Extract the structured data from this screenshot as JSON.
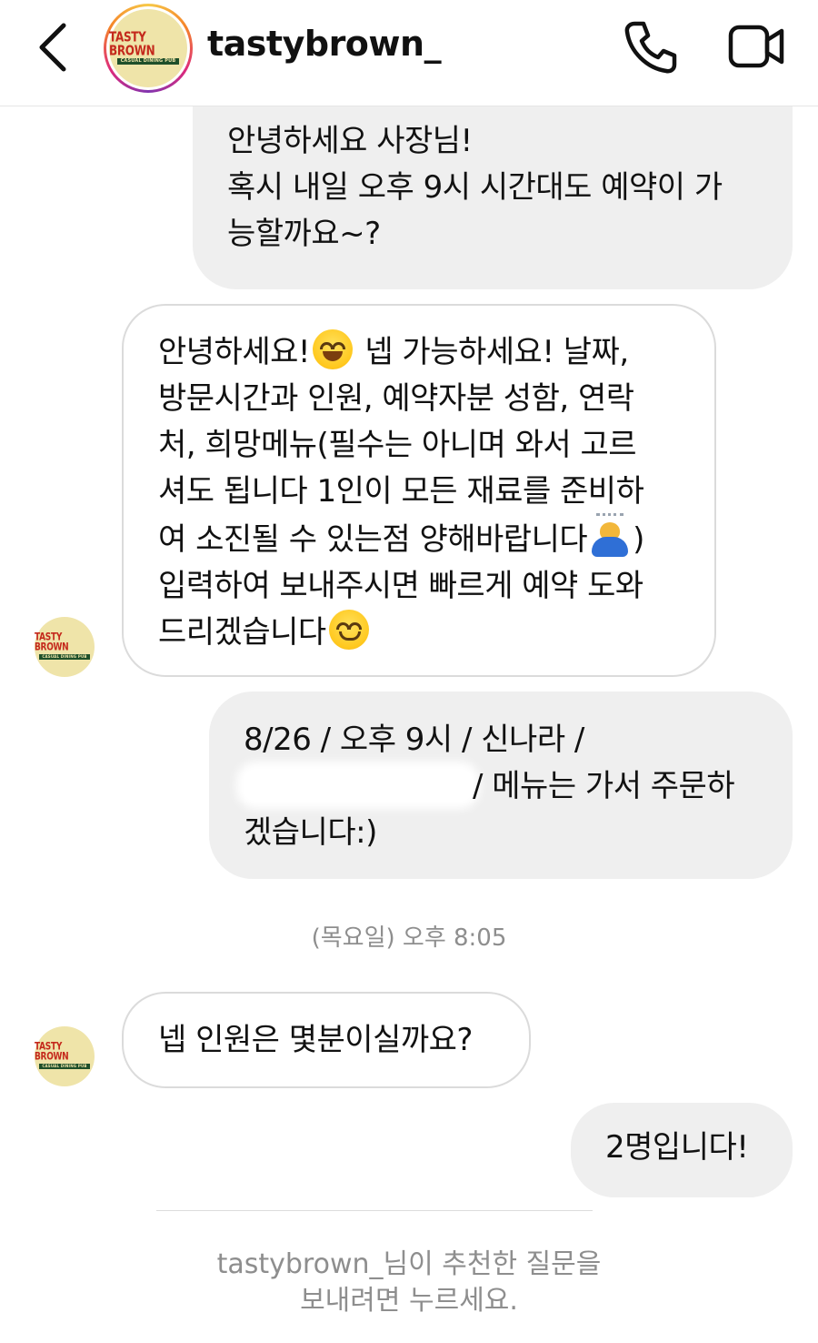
{
  "header": {
    "username": "tastybrown_",
    "back_icon": "chevron-left-icon",
    "call_icon": "phone-icon",
    "video_icon": "video-camera-icon"
  },
  "profile_logo": {
    "name": "TASTY BROWN",
    "subtitle": "CASUAL DINING PUB"
  },
  "messages": [
    {
      "direction": "outgoing",
      "lines": [
        "안녕하세요 사장님!",
        "혹시 내일 오후 9시 시간대도 예약이 가",
        "능할까요~?"
      ]
    },
    {
      "direction": "incoming",
      "line1_a": "안녕하세요!",
      "line1_b": " 넵 가능하세요! 날짜,",
      "line2": "방문시간과 인원, 예약자분 성함, 연락",
      "line3": "처, 희망메뉴(필수는 아니며 와서 고르",
      "line4": "셔도 됩니다 1인이 모든 재료를 준비하",
      "line5_a": "여 소진될 수 있는점 양해바랍니다",
      "line5_b": ")",
      "line6": "입력하여 보내주시면 빠르게 예약 도와",
      "line7": "드리겠습니다",
      "emojis": [
        "grinning-face-icon",
        "person-bowing-icon",
        "smiling-face-icon"
      ]
    },
    {
      "direction": "outgoing",
      "line1": "8/26 / 오후 9시 / 신나라 /",
      "line2_b": "/ 메뉴는 가서 주문하",
      "line3": "겠습니다:)"
    },
    {
      "direction": "incoming",
      "text": "넵 인원은 몇분이실까요?"
    },
    {
      "direction": "outgoing",
      "text": "2명입니다!"
    }
  ],
  "timestamp": "(목요일) 오후 8:05",
  "suggestion": {
    "line1": "tastybrown_님이 추천한 질문을",
    "line2": "보내려면 누르세요."
  },
  "colors": {
    "outgoing_bubble": "#efefef",
    "incoming_border": "#dbdbdb",
    "muted_text": "#8e8e8e",
    "logo_red": "#c4291c",
    "logo_bg": "#efe4a9"
  }
}
